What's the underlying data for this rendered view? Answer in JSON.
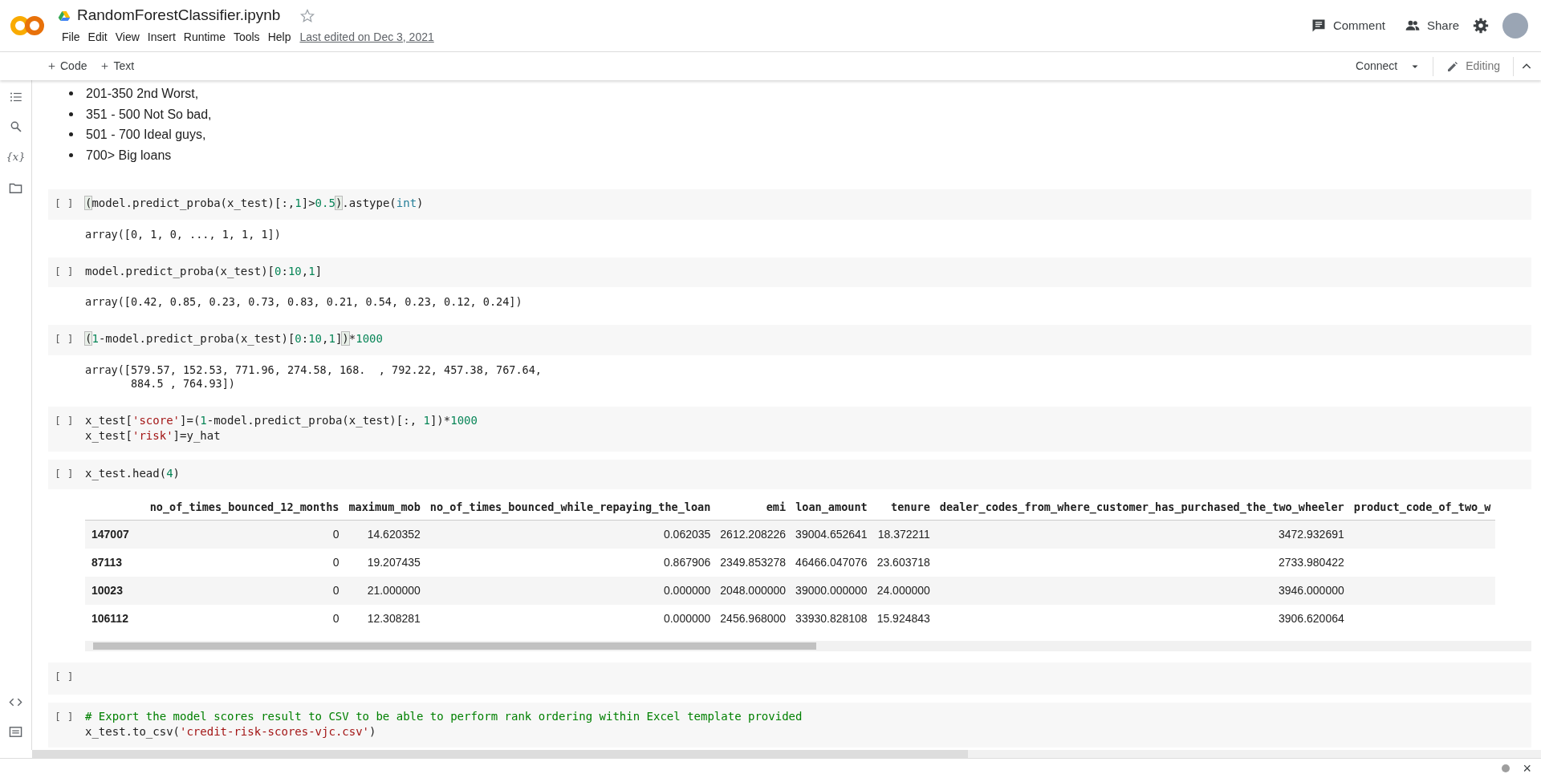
{
  "header": {
    "title": "RandomForestClassifier.ipynb",
    "starred": false,
    "menu": [
      "File",
      "Edit",
      "View",
      "Insert",
      "Runtime",
      "Tools",
      "Help"
    ],
    "last_edited": "Last edited on Dec 3, 2021",
    "actions": [
      "Comment",
      "Share"
    ]
  },
  "toolbar": {
    "add_buttons": [
      "Code",
      "Text"
    ],
    "connect": "Connect",
    "mode": "Editing"
  },
  "sidebar": {
    "variables_label": "{x}"
  },
  "text_cell": {
    "bullets": [
      "201-350 2nd Worst,",
      "351 - 500 Not So bad,",
      "501 - 700 Ideal guys,",
      "700> Big loans"
    ]
  },
  "cells": [
    {
      "prompt": "[ ]",
      "code": [
        [
          {
            "t": "(",
            "kind": "bracket"
          },
          {
            "t": "model.predict_proba(x_test)[:,",
            "kind": "plain"
          },
          {
            "t": "1",
            "kind": "num"
          },
          {
            "t": "]>",
            "kind": "plain"
          },
          {
            "t": "0.5",
            "kind": "num"
          },
          {
            "t": ")",
            "kind": "bracket"
          },
          {
            "t": ".astype(",
            "kind": "plain"
          },
          {
            "t": "int",
            "kind": "builtin"
          },
          {
            "t": ")",
            "kind": "plain"
          }
        ]
      ],
      "output": [
        "array([0, 1, 0, ..., 1, 1, 1])"
      ]
    },
    {
      "prompt": "[ ]",
      "code": [
        [
          {
            "t": "model.predict_proba(x_test)[",
            "kind": "plain"
          },
          {
            "t": "0",
            "kind": "num"
          },
          {
            "t": ":",
            "kind": "plain"
          },
          {
            "t": "10",
            "kind": "num"
          },
          {
            "t": ",",
            "kind": "plain"
          },
          {
            "t": "1",
            "kind": "num"
          },
          {
            "t": "]",
            "kind": "plain"
          }
        ]
      ],
      "output": [
        "array([0.42, 0.85, 0.23, 0.73, 0.83, 0.21, 0.54, 0.23, 0.12, 0.24])"
      ]
    },
    {
      "prompt": "[ ]",
      "code": [
        [
          {
            "t": "(",
            "kind": "bracket"
          },
          {
            "t": "1",
            "kind": "num"
          },
          {
            "t": "-model.predict_proba(x_test)[",
            "kind": "plain"
          },
          {
            "t": "0",
            "kind": "num"
          },
          {
            "t": ":",
            "kind": "plain"
          },
          {
            "t": "10",
            "kind": "num"
          },
          {
            "t": ",",
            "kind": "plain"
          },
          {
            "t": "1",
            "kind": "num"
          },
          {
            "t": "]",
            "kind": "plain"
          },
          {
            "t": ")",
            "kind": "bracket"
          },
          {
            "t": "*",
            "kind": "plain"
          },
          {
            "t": "1000",
            "kind": "num"
          }
        ]
      ],
      "output": [
        "array([579.57, 152.53, 771.96, 274.58, 168.  , 792.22, 457.38, 767.64,",
        "       884.5 , 764.93])"
      ]
    },
    {
      "prompt": "[ ]",
      "code": [
        [
          {
            "t": "x_test[",
            "kind": "plain"
          },
          {
            "t": "'score'",
            "kind": "str"
          },
          {
            "t": "]=(",
            "kind": "plain"
          },
          {
            "t": "1",
            "kind": "num"
          },
          {
            "t": "-model.predict_proba(x_test)[:, ",
            "kind": "plain"
          },
          {
            "t": "1",
            "kind": "num"
          },
          {
            "t": "])*",
            "kind": "plain"
          },
          {
            "t": "1000",
            "kind": "num"
          }
        ],
        [
          {
            "t": "x_test[",
            "kind": "plain"
          },
          {
            "t": "'risk'",
            "kind": "str"
          },
          {
            "t": "]=y_hat",
            "kind": "plain"
          }
        ]
      ]
    },
    {
      "prompt": "[ ]",
      "code": [
        [
          {
            "t": "x_test.head(",
            "kind": "plain"
          },
          {
            "t": "4",
            "kind": "num"
          },
          {
            "t": ")",
            "kind": "plain"
          }
        ]
      ],
      "table": {
        "columns": [
          "no_of_times_bounced_12_months",
          "maximum_mob",
          "no_of_times_bounced_while_repaying_the_loan",
          "emi",
          "loan_amount",
          "tenure",
          "dealer_codes_from_where_customer_has_purchased_the_two_wheeler",
          "product_code_of_two_w"
        ],
        "rows": [
          {
            "index": "147007",
            "cells": [
              "0",
              "14.620352",
              "0.062035",
              "2612.208226",
              "39004.652641",
              "18.372211",
              "3472.932691"
            ]
          },
          {
            "index": "87113",
            "cells": [
              "0",
              "19.207435",
              "0.867906",
              "2349.853278",
              "46466.047076",
              "23.603718",
              "2733.980422"
            ]
          },
          {
            "index": "10023",
            "cells": [
              "0",
              "21.000000",
              "0.000000",
              "2048.000000",
              "39000.000000",
              "24.000000",
              "3946.000000"
            ]
          },
          {
            "index": "106112",
            "cells": [
              "0",
              "12.308281",
              "0.000000",
              "2456.968000",
              "33930.828108",
              "15.924843",
              "3906.620064"
            ]
          }
        ]
      }
    },
    {
      "prompt": "[ ]"
    },
    {
      "prompt": "[ ]",
      "code": [
        [
          {
            "t": "# Export the model scores result to CSV to be able to perform rank ordering within Excel template provided",
            "kind": "comment"
          }
        ],
        [
          {
            "t": "x_test.to_csv(",
            "kind": "plain"
          },
          {
            "t": "'credit-risk-scores-vjc.csv'",
            "kind": "str"
          },
          {
            "t": ")",
            "kind": "plain"
          }
        ]
      ]
    }
  ],
  "status_bar": {
    "close": "×"
  }
}
